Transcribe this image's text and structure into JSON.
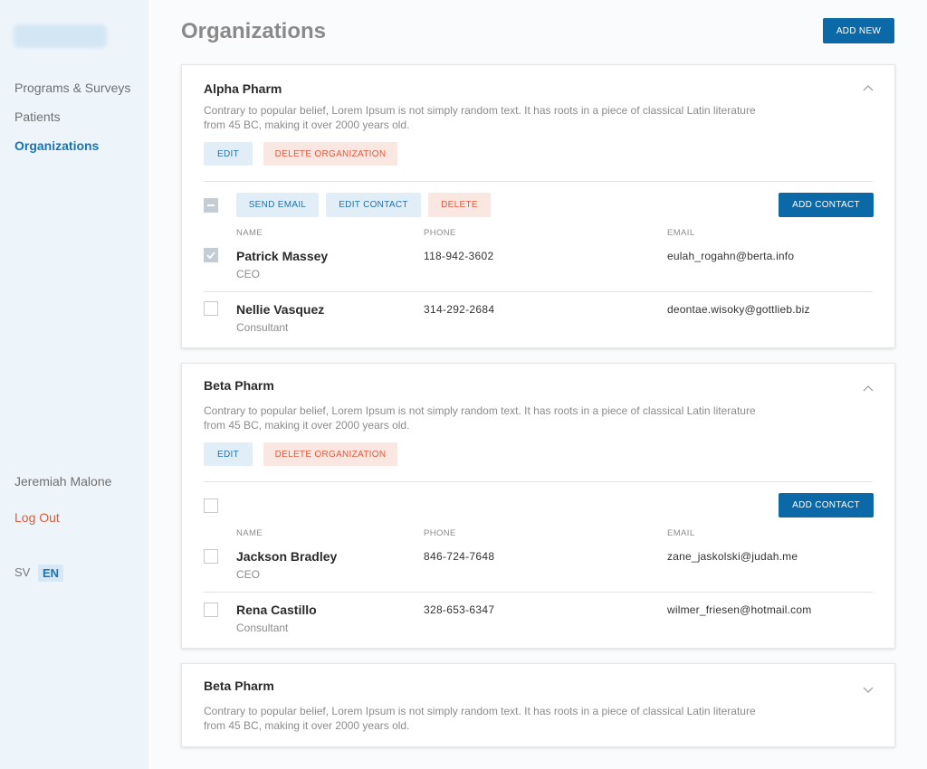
{
  "sidebar": {
    "nav": [
      {
        "label": "Programs & Surveys"
      },
      {
        "label": "Patients"
      },
      {
        "label": "Organizations"
      }
    ],
    "user_name": "Jeremiah Malone",
    "logout": "Log Out",
    "lang_sv": "SV",
    "lang_en": "EN"
  },
  "header": {
    "title": "Organizations",
    "add_new": "ADD NEW"
  },
  "labels": {
    "edit": "EDIT",
    "delete_org": "DELETE ORGANIZATION",
    "send_email": "SEND EMAIL",
    "edit_contact": "EDIT CONTACT",
    "delete": "DELETE",
    "add_contact": "ADD CONTACT",
    "col_name": "NAME",
    "col_phone": "PHONE",
    "col_email": "EMAIL"
  },
  "orgs": [
    {
      "name": "Alpha Pharm",
      "desc": "Contrary to popular belief, Lorem Ipsum is not simply random text. It has roots in a piece of classical Latin literature from 45 BC, making it over 2000 years old.",
      "contacts": [
        {
          "name": "Patrick Massey",
          "role": "CEO",
          "phone": "118-942-3602",
          "email": "eulah_rogahn@berta.info",
          "checked": true
        },
        {
          "name": "Nellie Vasquez",
          "role": "Consultant",
          "phone": "314-292-2684",
          "email": "deontae.wisoky@gottlieb.biz",
          "checked": false
        }
      ]
    },
    {
      "name": "Beta Pharm",
      "desc": "Contrary to popular belief, Lorem Ipsum is not simply random text. It has roots in a piece of classical Latin literature from 45 BC, making it over 2000 years old.",
      "contacts": [
        {
          "name": "Jackson Bradley",
          "role": "CEO",
          "phone": "846-724-7648",
          "email": "zane_jaskolski@judah.me",
          "checked": false
        },
        {
          "name": "Rena Castillo",
          "role": "Consultant",
          "phone": "328-653-6347",
          "email": "wilmer_friesen@hotmail.com",
          "checked": false
        }
      ]
    },
    {
      "name": "Beta Pharm",
      "desc": "Contrary to popular belief, Lorem Ipsum is not simply random text. It has roots in a piece of classical Latin literature from 45 BC, making it over 2000 years old."
    }
  ],
  "colors": {
    "primary": "#0b69a8",
    "accent_text": "#1774b5",
    "danger": "#e05a3d",
    "sidebar_bg": "#eef5fa"
  }
}
